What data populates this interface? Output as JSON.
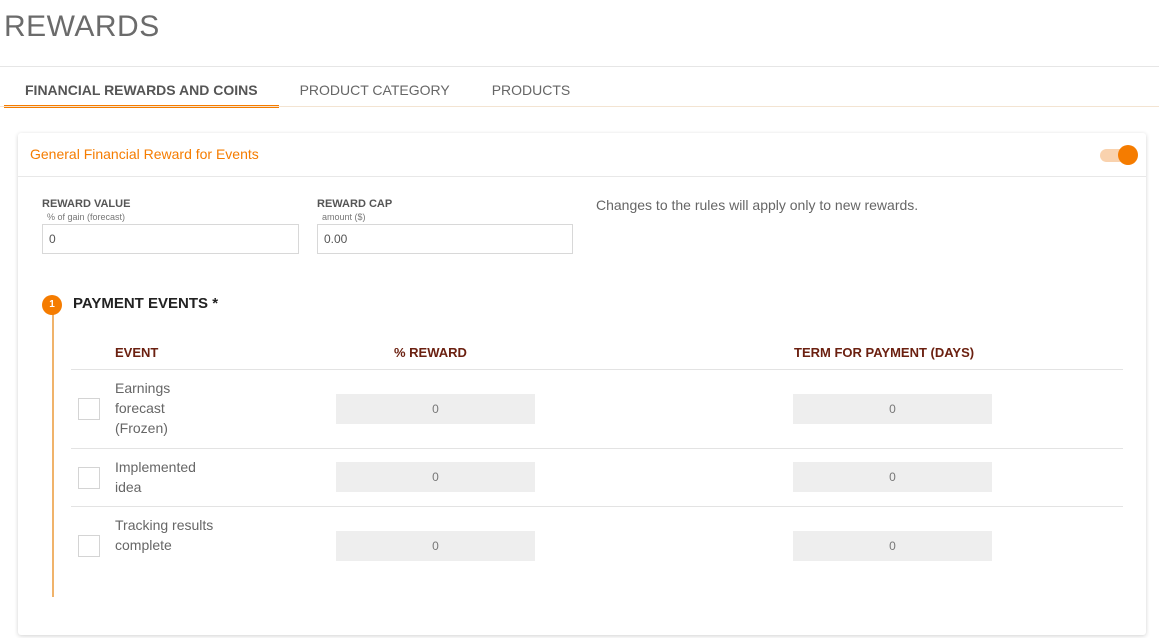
{
  "page": {
    "title": "REWARDS"
  },
  "tabs": [
    {
      "label": "FINANCIAL REWARDS AND COINS",
      "active": true
    },
    {
      "label": "PRODUCT CATEGORY",
      "active": false
    },
    {
      "label": "PRODUCTS",
      "active": false
    }
  ],
  "card": {
    "title": "General Financial Reward for Events",
    "toggle_on": true,
    "reward_value": {
      "label": "REWARD VALUE",
      "sublabel": "% of gain (forecast)",
      "value": "0"
    },
    "reward_cap": {
      "label": "REWARD CAP",
      "sublabel": "amount ($)",
      "value": "0.00"
    },
    "notice": "Changes to the rules will apply only to new rewards.",
    "section": {
      "step": "1",
      "title": "PAYMENT EVENTS *",
      "columns": [
        "EVENT",
        "% REWARD",
        "TERM FOR PAYMENT (DAYS)"
      ],
      "rows": [
        {
          "event": "Earnings forecast (Frozen)",
          "checked": false,
          "reward": "0",
          "term": "0"
        },
        {
          "event": "Implemented idea",
          "checked": false,
          "reward": "0",
          "term": "0"
        },
        {
          "event": "Tracking results complete",
          "checked": false,
          "reward": "0",
          "term": "0"
        }
      ]
    }
  },
  "colors": {
    "accent": "#f57c00",
    "accent_light": "#f9d2ae",
    "header_text": "#6b2010"
  }
}
